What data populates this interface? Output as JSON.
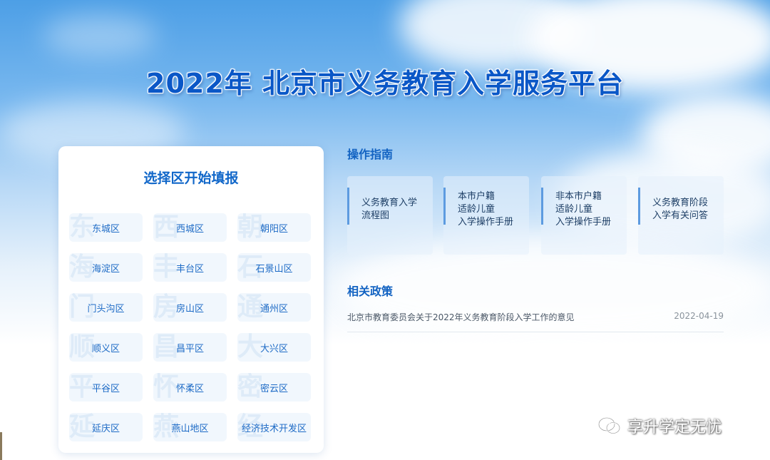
{
  "page": {
    "title": "2022年 北京市义务教育入学服务平台"
  },
  "district_panel": {
    "title": "选择区开始填报",
    "districts": [
      {
        "label": "东城区",
        "bg_char": "东"
      },
      {
        "label": "西城区",
        "bg_char": "西"
      },
      {
        "label": "朝阳区",
        "bg_char": "朝"
      },
      {
        "label": "海淀区",
        "bg_char": "海"
      },
      {
        "label": "丰台区",
        "bg_char": "丰"
      },
      {
        "label": "石景山区",
        "bg_char": "石"
      },
      {
        "label": "门头沟区",
        "bg_char": "门"
      },
      {
        "label": "房山区",
        "bg_char": "房"
      },
      {
        "label": "通州区",
        "bg_char": "通"
      },
      {
        "label": "顺义区",
        "bg_char": "顺"
      },
      {
        "label": "昌平区",
        "bg_char": "昌"
      },
      {
        "label": "大兴区",
        "bg_char": "大"
      },
      {
        "label": "平谷区",
        "bg_char": "平"
      },
      {
        "label": "怀柔区",
        "bg_char": "怀"
      },
      {
        "label": "密云区",
        "bg_char": "密"
      },
      {
        "label": "延庆区",
        "bg_char": "延"
      },
      {
        "label": "燕山地区",
        "bg_char": "燕"
      },
      {
        "label": "经济技术开发区",
        "bg_char": "经"
      }
    ]
  },
  "guide": {
    "title": "操作指南",
    "items": [
      {
        "lines": [
          "义务教育入学",
          "流程图"
        ]
      },
      {
        "lines": [
          "本市户籍",
          "适龄儿童",
          "入学操作手册"
        ]
      },
      {
        "lines": [
          "非本市户籍",
          "适龄儿童",
          "入学操作手册"
        ]
      },
      {
        "lines": [
          "义务教育阶段",
          "入学有关问答"
        ]
      }
    ]
  },
  "policy": {
    "title": "相关政策",
    "items": [
      {
        "text": "北京市教育委员会关于2022年义务教育阶段入学工作的意见",
        "date": "2022-04-19"
      }
    ]
  },
  "watermark": {
    "text": "享升学定无忧",
    "icon": "wechat-icon"
  },
  "colors": {
    "title_blue": "#0a57c7",
    "accent_blue": "#1363c2",
    "district_bg": "#f1f7fd"
  }
}
